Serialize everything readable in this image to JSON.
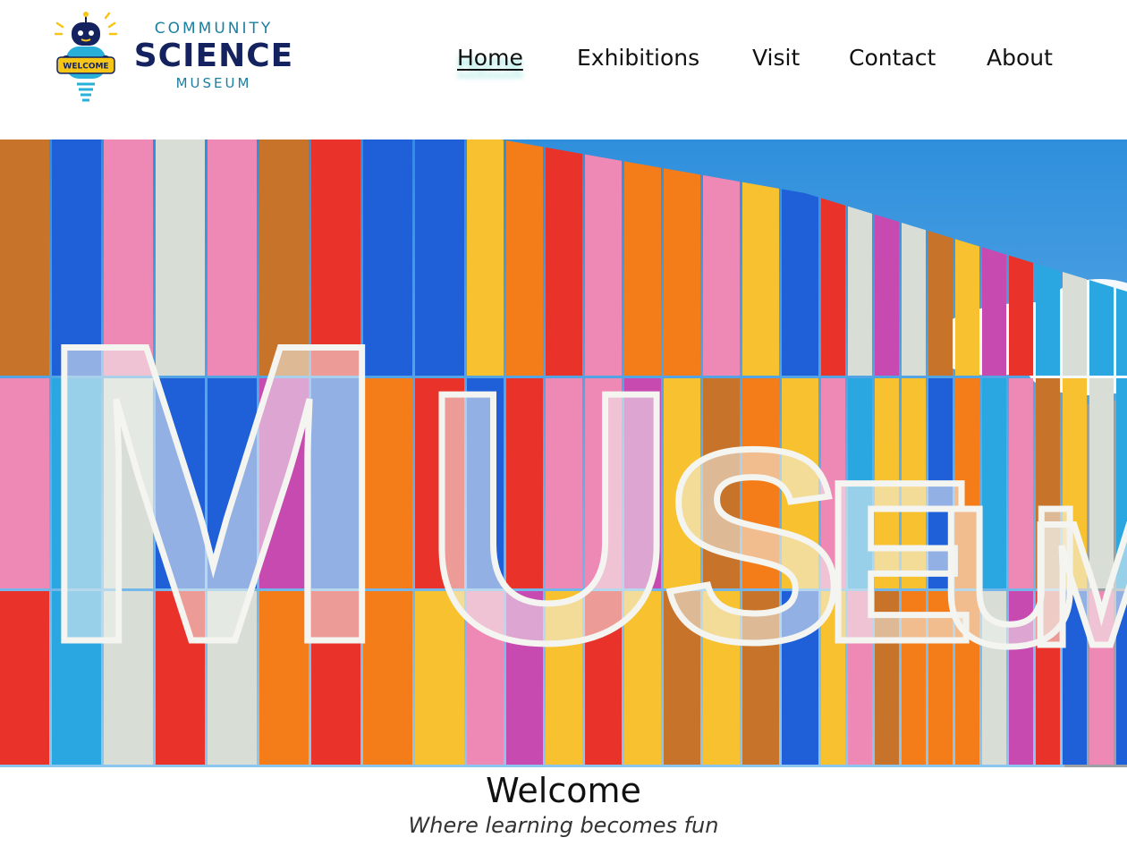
{
  "brand": {
    "line1": "COMMUNITY",
    "line2": "SCIENCE",
    "line3": "MUSEUM",
    "mascot_sign": "WELCOME",
    "colors": {
      "navy": "#14235f",
      "teal": "#1a7fa0",
      "yellow": "#f5c518"
    }
  },
  "nav": {
    "items": [
      {
        "label": "Home",
        "active": true
      },
      {
        "label": "Exhibitions",
        "active": false
      },
      {
        "label": "Visit",
        "active": false
      },
      {
        "label": "Contact",
        "active": false
      },
      {
        "label": "About",
        "active": false
      }
    ],
    "active_glow_color": "#28c8be"
  },
  "hero": {
    "image": "colorful-museum-facade-photo",
    "sign_text": "MUSEUM",
    "sky_color": "#3b9be0",
    "panel_colors": [
      "#f7c12f",
      "#e8322a",
      "#1f5fd8",
      "#ee88b4",
      "#f47d1a",
      "#d8ddd6",
      "#c64ab0",
      "#2aa6e0",
      "#c8732a"
    ]
  },
  "welcome": {
    "title": "Welcome",
    "subtitle": "Where learning becomes fun"
  }
}
